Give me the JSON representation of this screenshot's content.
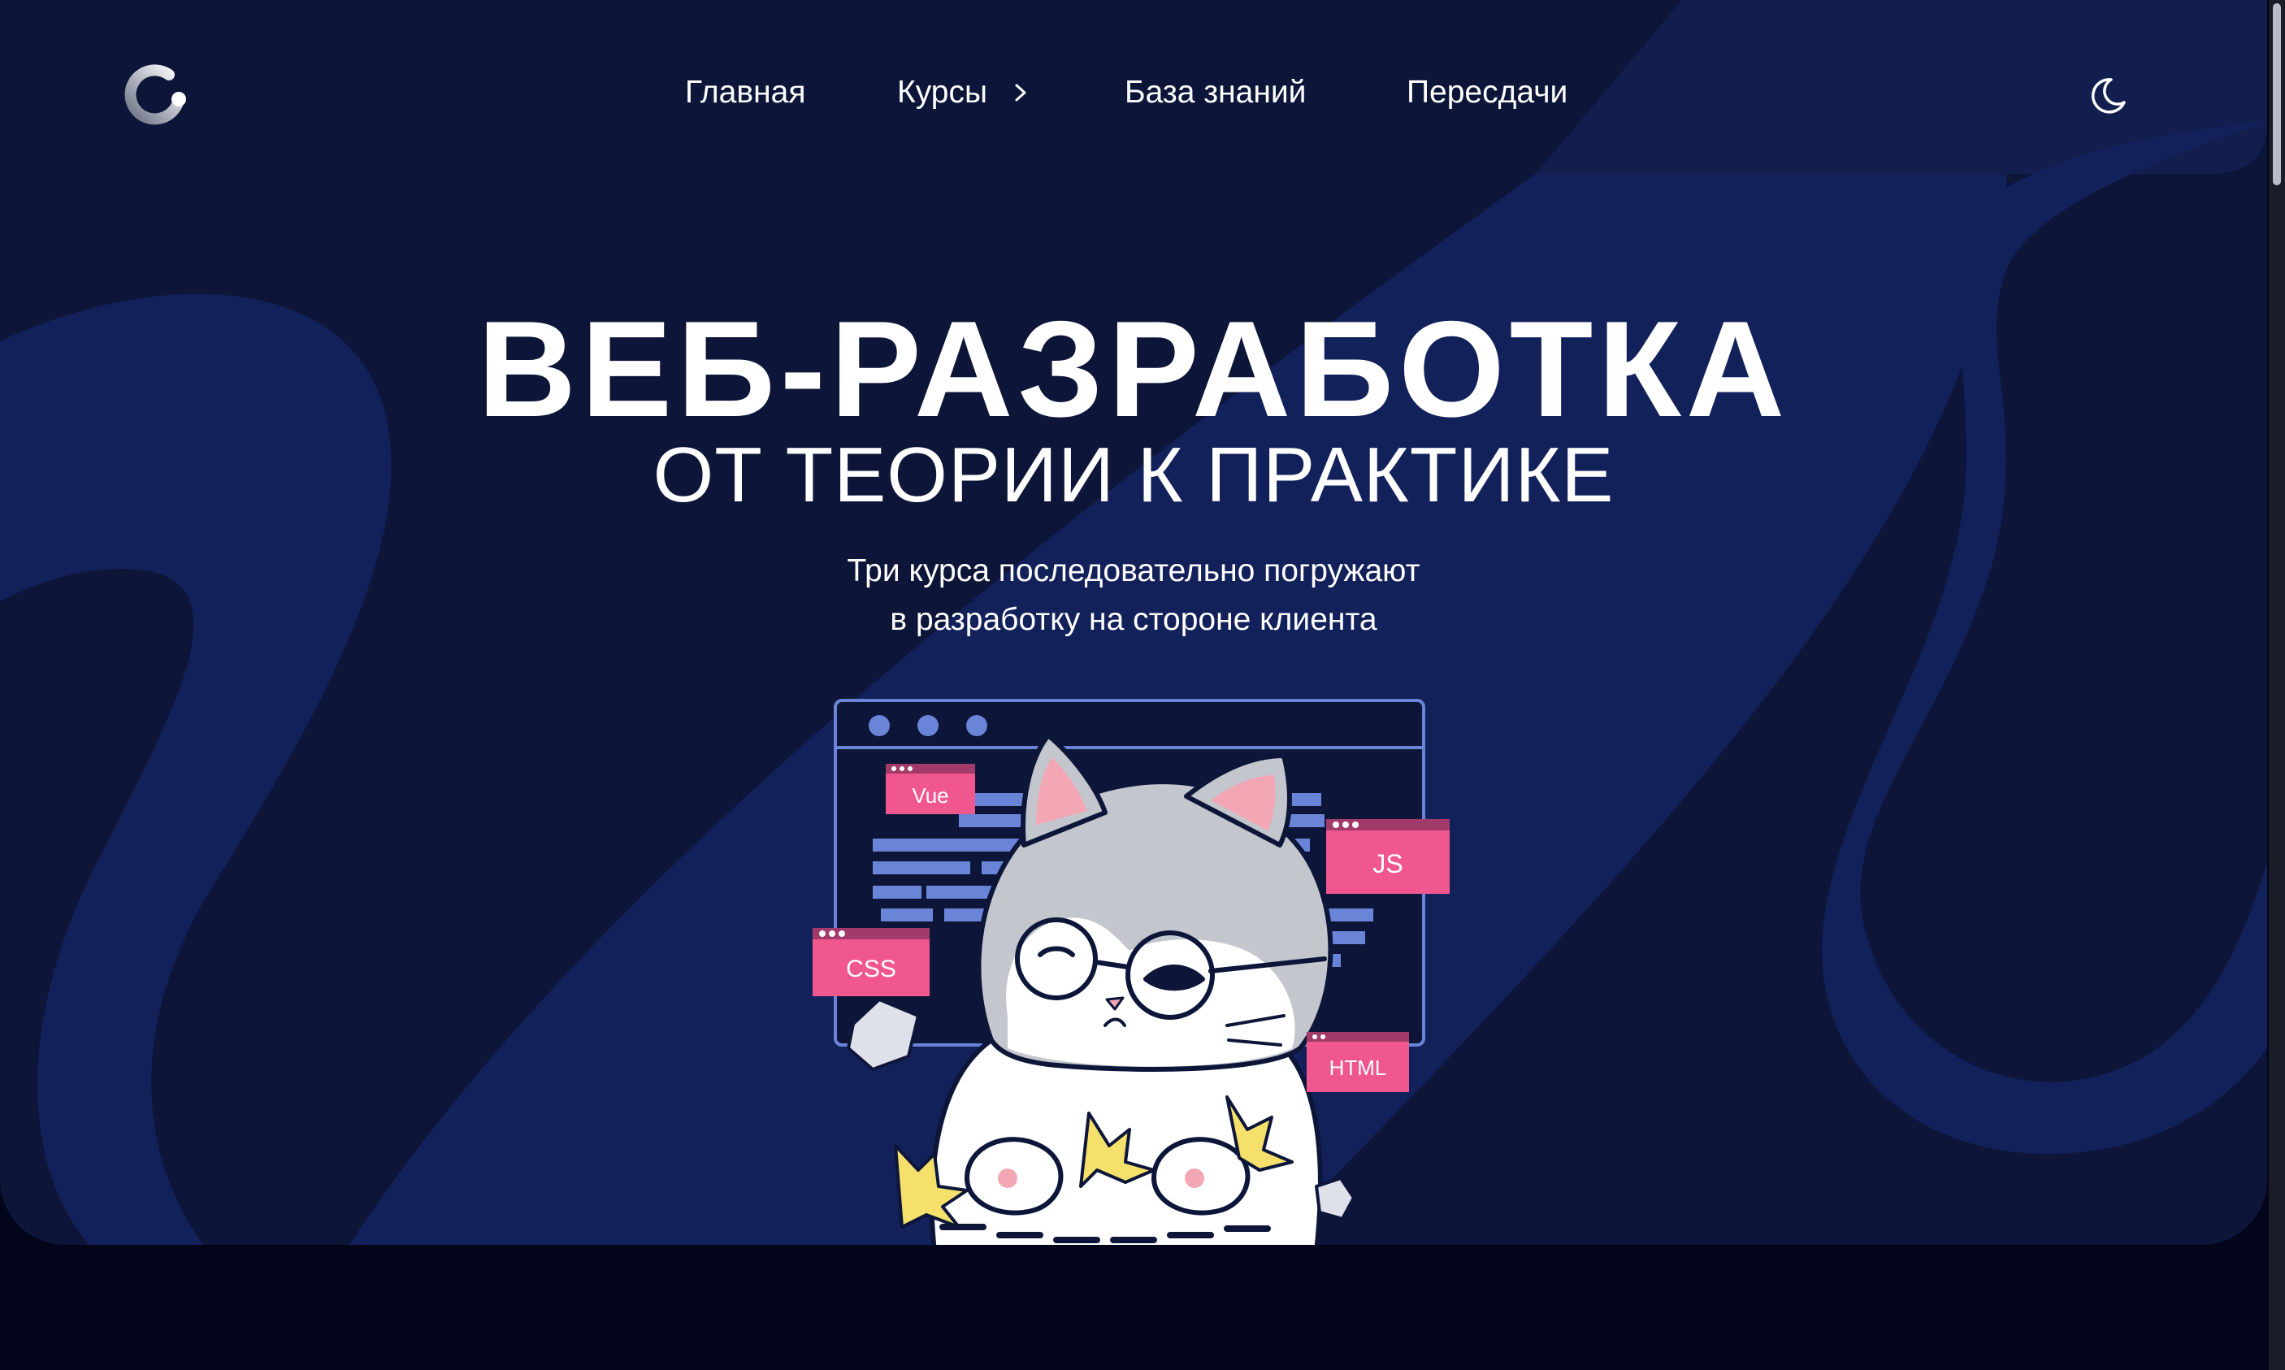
{
  "header": {
    "logo_icon": "loop-logo-icon",
    "nav": [
      {
        "label": "Главная"
      },
      {
        "label": "Курсы",
        "icon": "chevron-right-icon"
      },
      {
        "label": "База знаний"
      },
      {
        "label": "Пересдачи"
      }
    ],
    "theme_icon": "moon-icon"
  },
  "hero": {
    "title": "ВЕБ-РАЗРАБОТКА",
    "subtitle": "ОТ ТЕОРИИ К ПРАКТИКЕ",
    "description_line1": "Три курса последовательно погружают",
    "description_line2": "в разработку на стороне клиента"
  },
  "illustration": {
    "tags": {
      "vue": "Vue",
      "js": "JS",
      "css": "CSS",
      "html": "HTML"
    }
  },
  "colors": {
    "page_bg": "#03051a",
    "hero_bg": "#0d1639",
    "hero_wave": "#13215b",
    "accent_pink": "#f0578e",
    "code_lines": "#6a84d8"
  }
}
